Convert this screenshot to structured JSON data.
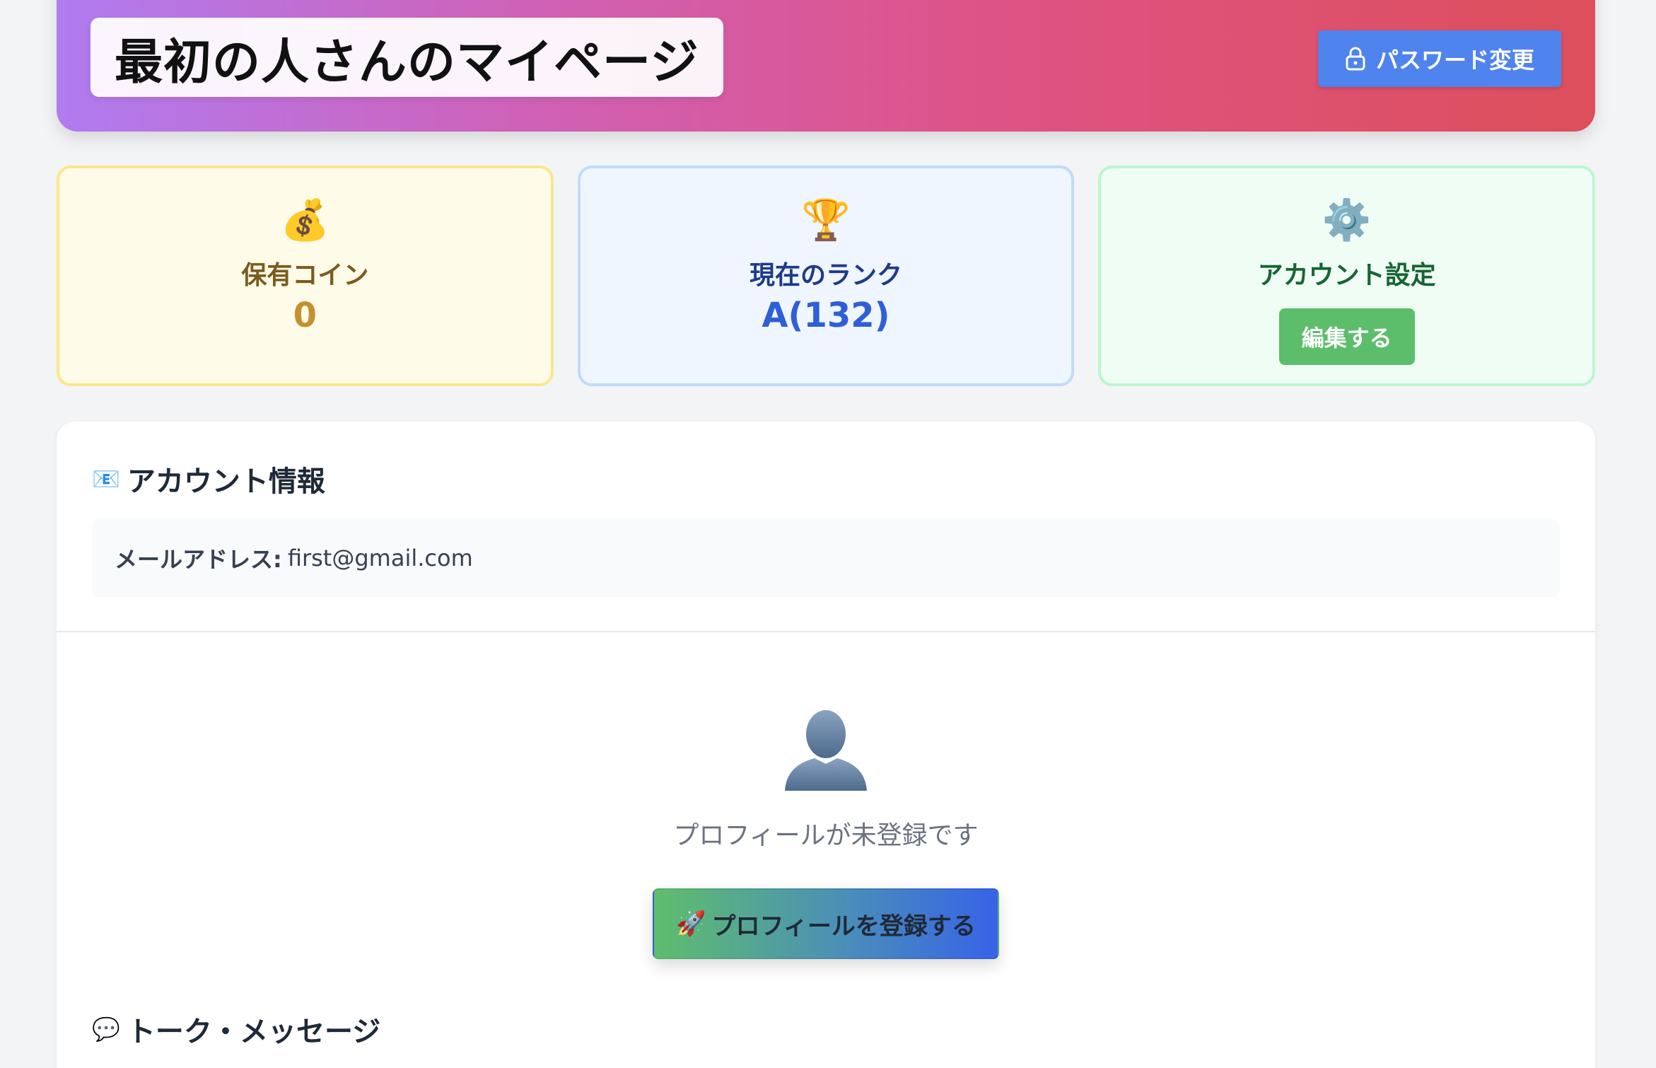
{
  "header": {
    "title": "最初の人さんのマイページ",
    "password_button": "パスワード変更",
    "gradient": [
      "#b07cf0",
      "#cf62b8",
      "#de5387",
      "#dd4f5a"
    ]
  },
  "cards": {
    "coins": {
      "icon": "💰",
      "label": "保有コイン",
      "value": "0"
    },
    "rank": {
      "icon": "🏆",
      "label": "現在のランク",
      "value": "A(132)"
    },
    "settings": {
      "icon": "⚙️",
      "label": "アカウント設定",
      "button": "編集する"
    }
  },
  "account": {
    "icon": "📧",
    "title": "アカウント情報",
    "email_label": "メールアドレス:",
    "email_value": "first@gmail.com"
  },
  "profile": {
    "empty_text": "プロフィールが未登録です",
    "register_icon": "🚀",
    "register_button": "プロフィールを登録する"
  },
  "talk": {
    "icon": "💬",
    "title": "トーク・メッセージ"
  },
  "colors": {
    "accent_blue": "#4f83ee",
    "success_green": "#5cbd6a",
    "background": "#f3f4f6"
  }
}
